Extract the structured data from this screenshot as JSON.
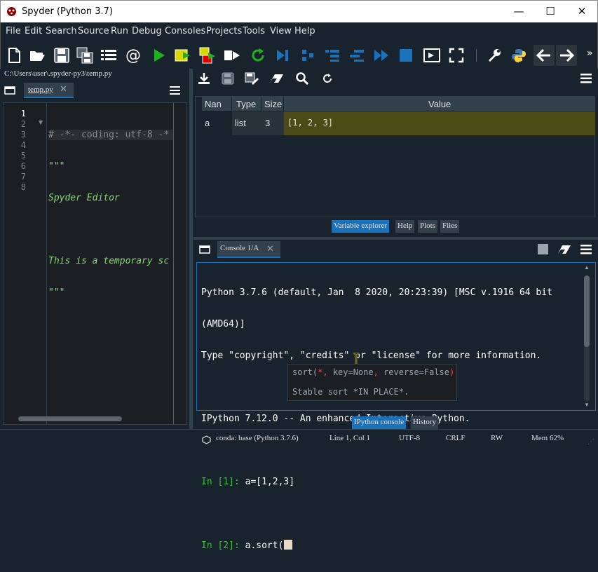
{
  "window": {
    "title": "Spyder (Python 3.7)",
    "minimize": "—",
    "maximize": "☐",
    "close": "✕"
  },
  "menu": [
    "File",
    "Edit",
    "Search",
    "Source",
    "Run",
    "Debug",
    "Consoles",
    "Projects",
    "Tools",
    "View",
    "Help"
  ],
  "toolbar_more": "»",
  "path": "C:\\Users\\user\\.spyder-py3\\temp.py",
  "editor": {
    "tab": "temp.py",
    "line_numbers": [
      "1",
      "2",
      "3",
      "4",
      "5",
      "6",
      "7",
      "8"
    ],
    "lines": [
      "# -*- coding: utf-8 -*",
      "\"\"\"",
      "Spyder Editor",
      "",
      "This is a temporary sc",
      "\"\"\"",
      "",
      ""
    ]
  },
  "varexp": {
    "headers": [
      "Nan",
      "Type",
      "Size",
      "Value"
    ],
    "rows": [
      {
        "name": "a",
        "type": "list",
        "size": "3",
        "value": "[1, 2, 3]"
      }
    ],
    "tabs": [
      "Variable explorer",
      "Help",
      "Plots",
      "Files"
    ]
  },
  "console": {
    "tab": "Console 1/A",
    "banner1": "Python 3.7.6 (default, Jan  8 2020, 20:23:39) [MSC v.1916 64 bit",
    "banner2": "(AMD64)]",
    "banner3": "Type \"copyright\", \"credits\" or \"license\" for more information.",
    "banner4": "IPython 7.12.0 -- An enhanced Interactive Python.",
    "in1_prompt": "In [1]:",
    "in1_code": " a=[1,2,3]",
    "in2_prompt": "In [2]:",
    "in2_code": " a.sort(",
    "calltip": {
      "func": "sort(",
      "star": "*",
      "sep1": ", ",
      "k1": "key=None",
      "sep2": ", ",
      "k2": "reverse=False",
      "close": ")",
      "doc": "Stable sort *IN PLACE*."
    },
    "tabs": [
      "IPython console",
      "History"
    ]
  },
  "status": {
    "env": "conda: base (Python 3.7.6)",
    "pos": "Line 1, Col 1",
    "enc": "UTF-8",
    "eol": "CRLF",
    "rw": "RW",
    "mem": "Mem 62%"
  },
  "colors": {
    "bg": "#19232d",
    "accent": "#1a72bb",
    "highlight": "#4b4b16",
    "prompt": "#38c038",
    "string": "#8bd672",
    "comment": "#888888"
  }
}
